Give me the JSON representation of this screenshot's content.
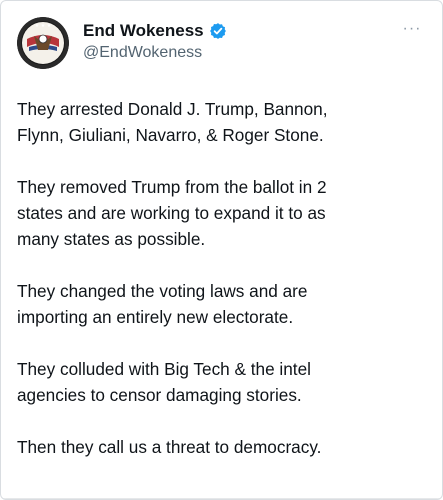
{
  "tweet": {
    "display_name": "End Wokeness",
    "handle": "@EndWokeness",
    "verified": true,
    "avatar_icon": "eagle-flag-badge-icon",
    "more_icon": "more-horizontal-icon",
    "paragraphs": [
      "They arrested Donald J. Trump, Bannon,\nFlynn, Giuliani, Navarro, & Roger Stone.",
      "They removed Trump from the ballot in 2\nstates and are working to expand it to as\nmany states as possible.",
      "They changed the voting laws and are\nimporting an entirely new electorate.",
      "They colluded with Big Tech & the intel\nagencies to censor damaging stories.",
      "Then they call us a threat to democracy."
    ]
  },
  "colors": {
    "text": "#0f1419",
    "secondary": "#536471",
    "verified": "#1d9bf0"
  }
}
